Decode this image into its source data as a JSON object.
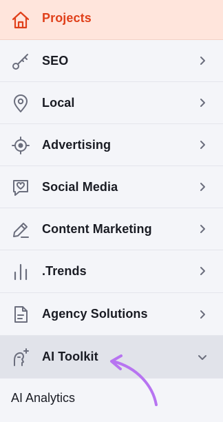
{
  "nav": {
    "items": [
      {
        "label": "Projects",
        "icon": "home-icon"
      },
      {
        "label": "SEO",
        "icon": "key-icon"
      },
      {
        "label": "Local",
        "icon": "map-pin-icon"
      },
      {
        "label": "Advertising",
        "icon": "crosshair-icon"
      },
      {
        "label": "Social Media",
        "icon": "chat-heart-icon"
      },
      {
        "label": "Content Marketing",
        "icon": "pencil-icon"
      },
      {
        "label": ".Trends",
        "icon": "bar-chart-icon"
      },
      {
        "label": "Agency Solutions",
        "icon": "document-icon"
      },
      {
        "label": "AI Toolkit",
        "icon": "ai-person-sparkle-icon",
        "expanded": true
      }
    ],
    "subitems": [
      {
        "label": "AI Analytics"
      }
    ]
  },
  "colors": {
    "accent": "#e0401a",
    "projects_bg": "#ffe5dc",
    "active_bg": "#e1e3ea",
    "annotation_arrow": "#b774f1"
  }
}
